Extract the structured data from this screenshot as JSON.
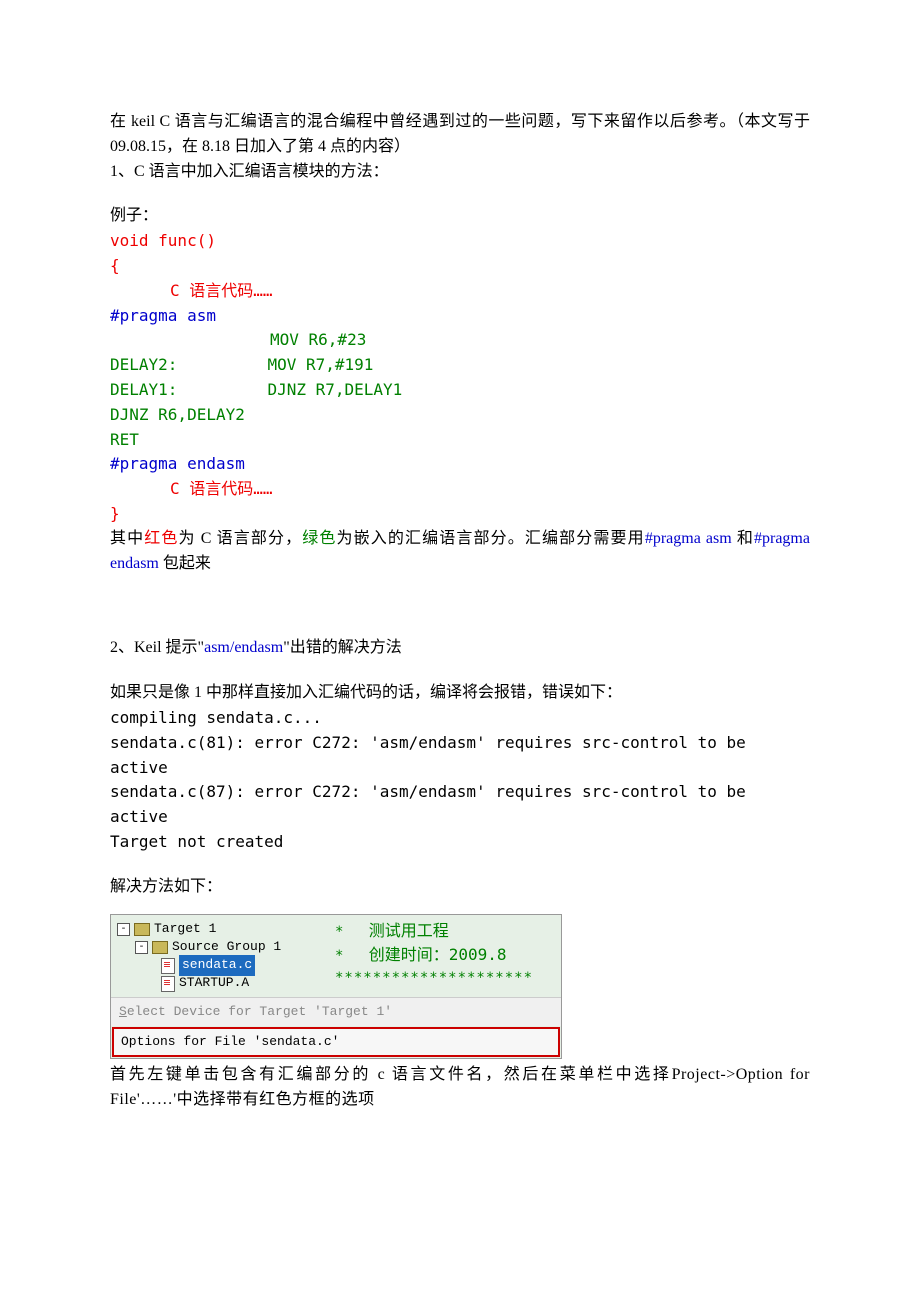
{
  "intro": {
    "line1": "在 keil C 语言与汇编语言的混合编程中曾经遇到过的一些问题，写下来留作以后参考。（本文写于 09.08.15，在 8.18 日加入了第 4 点的内容）",
    "line2": "1、C 语言中加入汇编语言模块的方法："
  },
  "example_label": "例子：",
  "code": {
    "l1": "void func()",
    "l2": "{",
    "l3": "C 语言代码……",
    "l4": "#pragma asm",
    "l5": "MOV R6,#23",
    "l6a": "DELAY2:",
    "l6b": "MOV R7,#191",
    "l7a": "DELAY1:",
    "l7b": "DJNZ R7,DELAY1",
    "l8": "DJNZ R6,DELAY2",
    "l9": "RET",
    "l10": "#pragma endasm",
    "l11": "C 语言代码……",
    "l12": "}"
  },
  "explain": {
    "p1a": "其中",
    "p1b": "红色",
    "p1c": "为 C 语言部分，",
    "p1d": "绿色",
    "p1e": "为嵌入的汇编语言部分。汇编部分需要用",
    "p1f": "#pragma asm",
    "p1g": " 和",
    "p1h": "#pragma endasm",
    "p1i": " 包起来"
  },
  "sec2": {
    "title_a": "2、Keil 提示\"",
    "title_b": "asm/endasm",
    "title_c": "\"出错的解决方法",
    "desc": "如果只是像 1 中那样直接加入汇编代码的话，编译将会报错，错误如下：",
    "err1": "compiling sendata.c...",
    "err2": "sendata.c(81): error C272: 'asm/endasm' requires src-control to be active",
    "err3": "sendata.c(87): error C272: 'asm/endasm' requires src-control to be active",
    "err4": "Target not created",
    "solve": "解决方法如下："
  },
  "tree": {
    "target": "Target 1",
    "group": "Source Group 1",
    "file1": "sendata.c",
    "file2": "STARTUP.A"
  },
  "rightbox": {
    "star": "*",
    "line1_b": "测试用工程",
    "line2_b": "创建时间：2009.8",
    "stars": "*********************"
  },
  "menu": {
    "row1_pre": "S",
    "row1": "elect Device for Target 'Target 1'",
    "row2": "Options for File 'sendata.c'"
  },
  "foot": {
    "p1": "首先左键单击包含有汇编部分的 c 语言文件名，然后在菜单栏中选择Project->Option for File'……'中选择带有红色方框的选项"
  }
}
